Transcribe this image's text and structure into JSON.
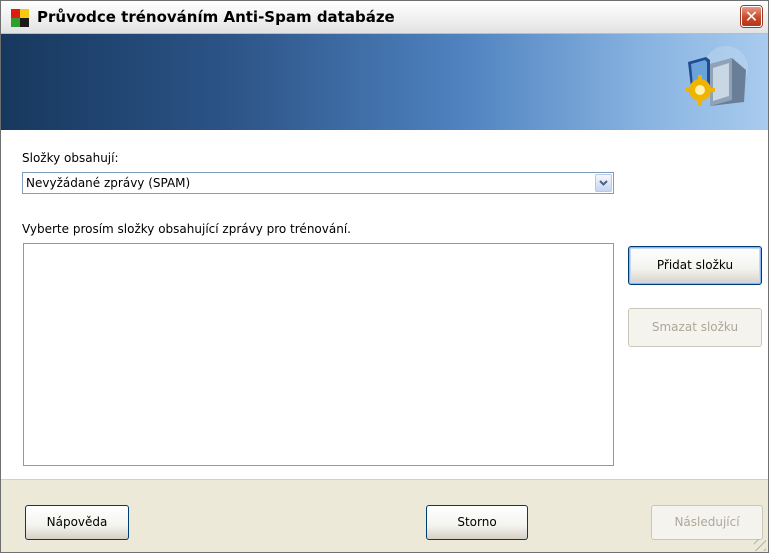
{
  "window": {
    "title": "Průvodce trénováním Anti-Spam databáze",
    "close_glyph": "✕"
  },
  "banner": {
    "icon": "antispam-shield-gear-icon"
  },
  "folders": {
    "label": "Složky obsahují:",
    "selected": "Nevyžádané zprávy (SPAM)"
  },
  "instructions": "Vyberte prosím složky obsahující zprávy pro trénování.",
  "folder_list": {
    "items": []
  },
  "buttons": {
    "add_folder": "Přidat složku",
    "delete_folder": "Smazat složku",
    "help": "Nápověda",
    "cancel": "Storno",
    "next": "Následující"
  },
  "colors": {
    "banner_dark": "#17385e",
    "banner_light": "#a9cbee",
    "close_red": "#c8492c",
    "footer_bg": "#ece9d8"
  }
}
